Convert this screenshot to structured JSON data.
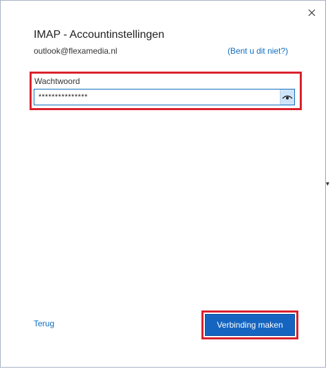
{
  "dialog": {
    "title": "IMAP - Accountinstellingen",
    "email": "outlook@flexamedia.nl",
    "not_you_link": "(Bent u dit niet?)"
  },
  "password": {
    "label": "Wachtwoord",
    "value": "***************",
    "show_icon": "eye-icon"
  },
  "footer": {
    "back_label": "Terug",
    "connect_label": "Verbinding maken"
  },
  "colors": {
    "accent": "#0f6cbd",
    "primary_button": "#1565c0",
    "highlight": "#d9202c"
  }
}
